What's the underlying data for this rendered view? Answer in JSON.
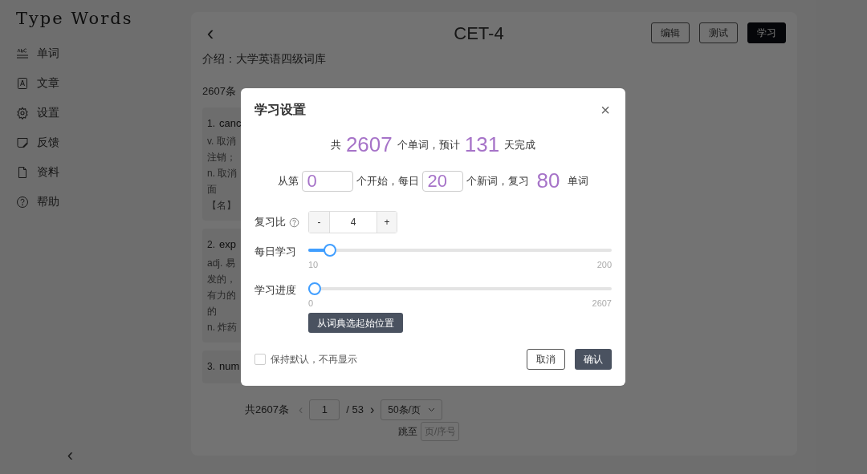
{
  "sidebar": {
    "logo": "Type Words",
    "items": [
      {
        "label": "单词"
      },
      {
        "label": "文章"
      },
      {
        "label": "设置"
      },
      {
        "label": "反馈"
      },
      {
        "label": "资料"
      },
      {
        "label": "帮助"
      }
    ],
    "collapse": "‹"
  },
  "header": {
    "back": "‹",
    "title": "CET-4",
    "buttons": [
      {
        "label": "编辑",
        "primary": false
      },
      {
        "label": "测试",
        "primary": false
      },
      {
        "label": "学习",
        "primary": true
      }
    ]
  },
  "intro": "介绍：大学英语四级词库",
  "count": "2607条",
  "words": [
    {
      "index": "1.",
      "word": "canc",
      "lines": [
        "v. 取消",
        "注销；",
        "n. 取消",
        "面",
        "【名】"
      ]
    },
    {
      "index": "2.",
      "word": "exp",
      "lines": [
        "adj. 易",
        "发的，",
        "有力的",
        "的",
        "n. 炸药"
      ]
    },
    {
      "index": "3.",
      "word": "num"
    }
  ],
  "pagination": {
    "total": "共2607条",
    "prev": "‹",
    "page": "1",
    "pages": "/ 53",
    "next": "›",
    "page_size": "50条/页",
    "jump_label": "跳至",
    "jump_placeholder": "页/序号"
  },
  "dialog": {
    "title": "学习设置",
    "close": "×",
    "summary": [
      "共",
      "2607",
      "个单词，预计",
      "131",
      "天完成"
    ],
    "plan": {
      "from": "从第",
      "start": "0",
      "start_after": "个开始，每日",
      "daily": "20",
      "daily_after": "个新词，复习",
      "review": "80",
      "review_after": "单词"
    },
    "ratio": {
      "label": "复习比",
      "minus": "-",
      "value": "4",
      "plus": "+"
    },
    "sliders": [
      {
        "label": "每日学习",
        "level": 0.053,
        "min": "10",
        "max": "200"
      },
      {
        "label": "学习进度",
        "level": 0,
        "min": "0",
        "max": "2607"
      }
    ],
    "pick_button": "从词典选起始位置",
    "keep_default": {
      "label": "保持默认，不再显示",
      "checked": false
    },
    "cancel": "取消",
    "confirm": "确认"
  }
}
